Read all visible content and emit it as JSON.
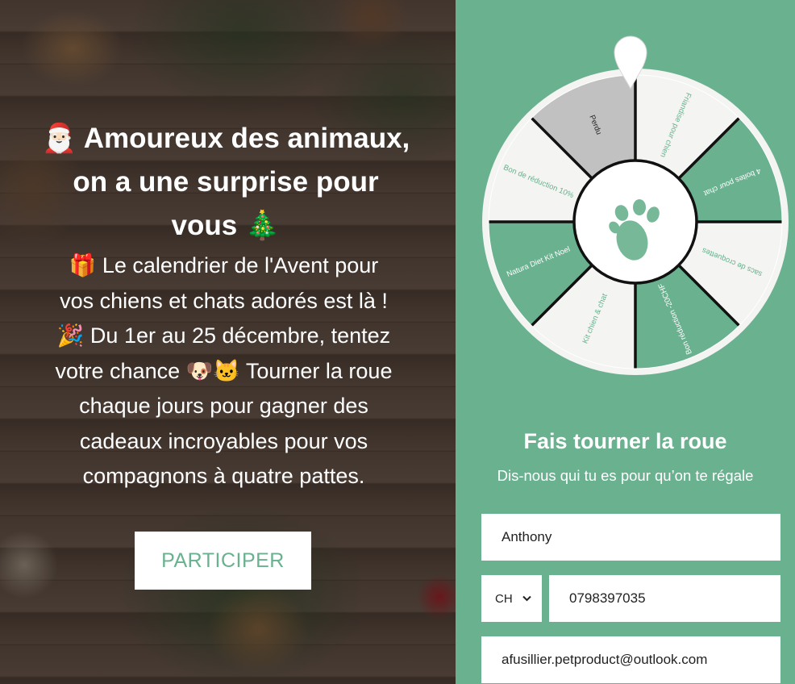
{
  "left_panel": {
    "headline_lines": [
      "🎅🏻 Amoureux des animaux,",
      "on a une surprise pour",
      "vous 🎄"
    ],
    "body_lines": [
      "🎁 Le calendrier de l'Avent pour",
      "vos chiens et chats adorés est là !",
      "🎉 Du 1er au 25 décembre, tentez",
      "votre chance 🐶🐱 Tourner la roue",
      "chaque jours pour gagner des",
      "cadeaux incroyables pour vos",
      "compagnons à quatre pattes."
    ],
    "cta_label": "PARTICIPER"
  },
  "wheel": {
    "segments": [
      {
        "label": "Perdu",
        "color": "#c1c1c1"
      },
      {
        "label": "Friandise pour chien",
        "color": "#f4f4f2"
      },
      {
        "label": "4 boites pour chat",
        "color": "#69b18f"
      },
      {
        "label": "sacs de croquettes",
        "color": "#f4f4f2"
      },
      {
        "label": "Bon réduction -20CHF",
        "color": "#69b18f"
      },
      {
        "label": "Kit chien & chat",
        "color": "#f4f4f2"
      },
      {
        "label": "Natura Diet Kit Noel",
        "color": "#69b18f"
      },
      {
        "label": "Bon de réduction 10%",
        "color": "#f4f4f2"
      }
    ],
    "center_icon": "paw-icon"
  },
  "form": {
    "title": "Fais tourner la roue",
    "subtitle": "Dis-nous qui tu es pour qu’on te régale",
    "name_value": "Anthony",
    "country_code": "CH",
    "phone_value": "0798397035",
    "email_value": "afusillier.petproduct@outlook.com"
  },
  "colors": {
    "accent_green": "#69b18f",
    "light_segment": "#f4f4f2",
    "lost_segment": "#c1c1c1"
  }
}
